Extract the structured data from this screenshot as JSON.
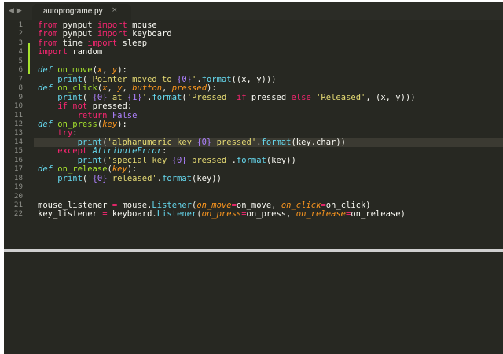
{
  "tabs": {
    "back_glyph": "◀",
    "forward_glyph": "▶",
    "active": {
      "title": "autoprograme.py",
      "close_glyph": "×"
    }
  },
  "editor": {
    "current_line": 14,
    "lines": [
      {
        "num": "1",
        "tokens": [
          [
            "kw",
            "from"
          ],
          [
            "pl",
            " pynput "
          ],
          [
            "kw",
            "import"
          ],
          [
            "pl",
            " mouse"
          ]
        ]
      },
      {
        "num": "2",
        "tokens": [
          [
            "kw",
            "from"
          ],
          [
            "pl",
            " pynput "
          ],
          [
            "kw",
            "import"
          ],
          [
            "pl",
            " keyboard"
          ]
        ]
      },
      {
        "num": "3",
        "tokens": [
          [
            "kw",
            "from"
          ],
          [
            "pl",
            " time "
          ],
          [
            "kw",
            "import"
          ],
          [
            "pl",
            " sleep"
          ]
        ]
      },
      {
        "num": "4",
        "tokens": [
          [
            "kw",
            "import"
          ],
          [
            "pl",
            " random"
          ]
        ]
      },
      {
        "num": "5",
        "tokens": []
      },
      {
        "num": "6",
        "tokens": [
          [
            "dk",
            "def"
          ],
          [
            "pl",
            " "
          ],
          [
            "fn",
            "on_move"
          ],
          [
            "pl",
            "("
          ],
          [
            "pa",
            "x"
          ],
          [
            "pl",
            ", "
          ],
          [
            "pa",
            "y"
          ],
          [
            "pl",
            "):"
          ]
        ]
      },
      {
        "num": "7",
        "tokens": [
          [
            "pl",
            "    "
          ],
          [
            "bi",
            "print"
          ],
          [
            "pl",
            "("
          ],
          [
            "st",
            "'Pointer moved to "
          ],
          [
            "nu",
            "{0}"
          ],
          [
            "st",
            "'"
          ],
          [
            "pl",
            "."
          ],
          [
            "bi",
            "format"
          ],
          [
            "pl",
            "((x, y)))"
          ]
        ]
      },
      {
        "num": "8",
        "tokens": [
          [
            "dk",
            "def"
          ],
          [
            "pl",
            " "
          ],
          [
            "fn",
            "on_click"
          ],
          [
            "pl",
            "("
          ],
          [
            "pa",
            "x"
          ],
          [
            "pl",
            ", "
          ],
          [
            "pa",
            "y"
          ],
          [
            "pl",
            ", "
          ],
          [
            "pa",
            "button"
          ],
          [
            "pl",
            ", "
          ],
          [
            "pa",
            "pressed"
          ],
          [
            "pl",
            "):"
          ]
        ]
      },
      {
        "num": "9",
        "tokens": [
          [
            "pl",
            "    "
          ],
          [
            "bi",
            "print"
          ],
          [
            "pl",
            "("
          ],
          [
            "st",
            "'"
          ],
          [
            "nu",
            "{0}"
          ],
          [
            "st",
            " at "
          ],
          [
            "nu",
            "{1}"
          ],
          [
            "st",
            "'"
          ],
          [
            "pl",
            "."
          ],
          [
            "bi",
            "format"
          ],
          [
            "pl",
            "("
          ],
          [
            "st",
            "'Pressed'"
          ],
          [
            "pl",
            " "
          ],
          [
            "kw",
            "if"
          ],
          [
            "pl",
            " pressed "
          ],
          [
            "kw",
            "else"
          ],
          [
            "pl",
            " "
          ],
          [
            "st",
            "'Released'"
          ],
          [
            "pl",
            ", (x, y)))"
          ]
        ]
      },
      {
        "num": "10",
        "tokens": [
          [
            "pl",
            "    "
          ],
          [
            "kw",
            "if"
          ],
          [
            "pl",
            " "
          ],
          [
            "kw",
            "not"
          ],
          [
            "pl",
            " pressed:"
          ]
        ]
      },
      {
        "num": "11",
        "tokens": [
          [
            "pl",
            "        "
          ],
          [
            "kw",
            "return"
          ],
          [
            "pl",
            " "
          ],
          [
            "nu",
            "False"
          ]
        ]
      },
      {
        "num": "12",
        "tokens": [
          [
            "dk",
            "def"
          ],
          [
            "pl",
            " "
          ],
          [
            "fn",
            "on_press"
          ],
          [
            "pl",
            "("
          ],
          [
            "pa",
            "key"
          ],
          [
            "pl",
            "):"
          ]
        ]
      },
      {
        "num": "13",
        "tokens": [
          [
            "pl",
            "    "
          ],
          [
            "kw",
            "try"
          ],
          [
            "pl",
            ":"
          ]
        ]
      },
      {
        "num": "14",
        "tokens": [
          [
            "pl",
            "        "
          ],
          [
            "bi",
            "print"
          ],
          [
            "pl",
            "("
          ],
          [
            "st",
            "'alphanumeric key "
          ],
          [
            "nu",
            "{0}"
          ],
          [
            "st",
            " pressed'"
          ],
          [
            "pl",
            "."
          ],
          [
            "bi",
            "format"
          ],
          [
            "pl",
            "(key.char))"
          ]
        ]
      },
      {
        "num": "15",
        "tokens": [
          [
            "pl",
            "    "
          ],
          [
            "kw",
            "except"
          ],
          [
            "pl",
            " "
          ],
          [
            "cl",
            "AttributeError"
          ],
          [
            "pl",
            ":"
          ]
        ]
      },
      {
        "num": "16",
        "tokens": [
          [
            "pl",
            "        "
          ],
          [
            "bi",
            "print"
          ],
          [
            "pl",
            "("
          ],
          [
            "st",
            "'special key "
          ],
          [
            "nu",
            "{0}"
          ],
          [
            "st",
            " pressed'"
          ],
          [
            "pl",
            "."
          ],
          [
            "bi",
            "format"
          ],
          [
            "pl",
            "(key))"
          ]
        ]
      },
      {
        "num": "17",
        "tokens": [
          [
            "dk",
            "def"
          ],
          [
            "pl",
            " "
          ],
          [
            "fn",
            "on_release"
          ],
          [
            "pl",
            "("
          ],
          [
            "pa",
            "key"
          ],
          [
            "pl",
            "):"
          ]
        ]
      },
      {
        "num": "18",
        "tokens": [
          [
            "pl",
            "    "
          ],
          [
            "bi",
            "print"
          ],
          [
            "pl",
            "("
          ],
          [
            "st",
            "'"
          ],
          [
            "nu",
            "{0}"
          ],
          [
            "st",
            " released'"
          ],
          [
            "pl",
            "."
          ],
          [
            "bi",
            "format"
          ],
          [
            "pl",
            "(key))"
          ]
        ]
      },
      {
        "num": "19",
        "tokens": []
      },
      {
        "num": "20",
        "tokens": []
      },
      {
        "num": "21",
        "tokens": [
          [
            "pl",
            "mouse_listener "
          ],
          [
            "kw",
            "="
          ],
          [
            "pl",
            " mouse."
          ],
          [
            "bi",
            "Listener"
          ],
          [
            "pl",
            "("
          ],
          [
            "ca",
            "on_move"
          ],
          [
            "kw",
            "="
          ],
          [
            "pl",
            "on_move, "
          ],
          [
            "ca",
            "on_click"
          ],
          [
            "kw",
            "="
          ],
          [
            "pl",
            "on_click)"
          ]
        ]
      },
      {
        "num": "22",
        "tokens": [
          [
            "pl",
            "key_listener "
          ],
          [
            "kw",
            "="
          ],
          [
            "pl",
            " keyboard."
          ],
          [
            "bi",
            "Listener"
          ],
          [
            "pl",
            "("
          ],
          [
            "ca",
            "on_press"
          ],
          [
            "kw",
            "="
          ],
          [
            "pl",
            "on_press, "
          ],
          [
            "ca",
            "on_release"
          ],
          [
            "kw",
            "="
          ],
          [
            "pl",
            "on_release)"
          ]
        ]
      }
    ]
  },
  "colors": {
    "background": "#272822",
    "keyword": "#f92672",
    "string": "#e6db74",
    "function": "#a6e22e",
    "builtin": "#66d9ef",
    "parameter": "#fd971f",
    "number": "#ae81ff",
    "text": "#f8f8f2",
    "line_number": "#8f908a"
  }
}
